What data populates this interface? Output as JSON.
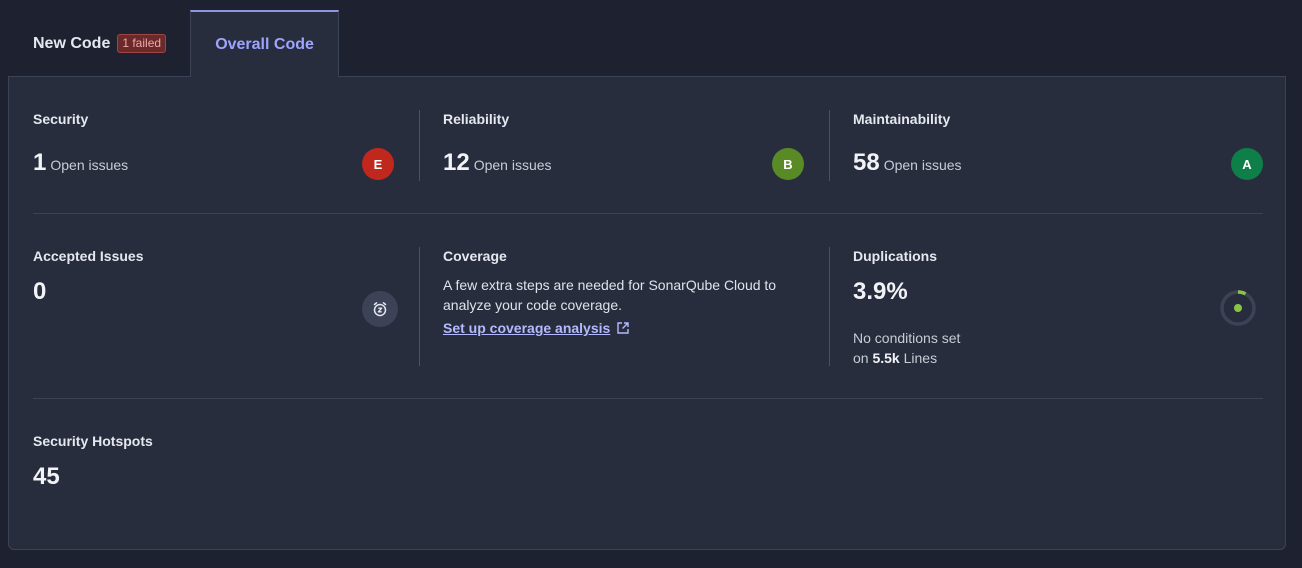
{
  "tabs": {
    "new_code": "New Code",
    "failed_badge": "1 failed",
    "overall_code": "Overall Code"
  },
  "security": {
    "title": "Security",
    "count": "1",
    "label": "Open issues",
    "grade": "E",
    "grade_color": "#c0281e"
  },
  "reliability": {
    "title": "Reliability",
    "count": "12",
    "label": "Open issues",
    "grade": "B",
    "grade_color": "#5a8a26"
  },
  "maintainability": {
    "title": "Maintainability",
    "count": "58",
    "label": "Open issues",
    "grade": "A",
    "grade_color": "#0e7f49"
  },
  "accepted": {
    "title": "Accepted Issues",
    "count": "0",
    "icon": "snooze-clock-icon"
  },
  "coverage": {
    "title": "Coverage",
    "description": "A few extra steps are needed for SonarQube Cloud to analyze your code coverage.",
    "link": "Set up coverage analysis",
    "link_icon": "external-link-icon"
  },
  "duplications": {
    "title": "Duplications",
    "value": "3.9%",
    "line1": "No conditions set",
    "line2_prefix": "on",
    "lines_value": "5.5k",
    "line2_suffix": "Lines",
    "ratio": 0.039
  },
  "hotspots": {
    "title": "Security Hotspots",
    "count": "45"
  }
}
